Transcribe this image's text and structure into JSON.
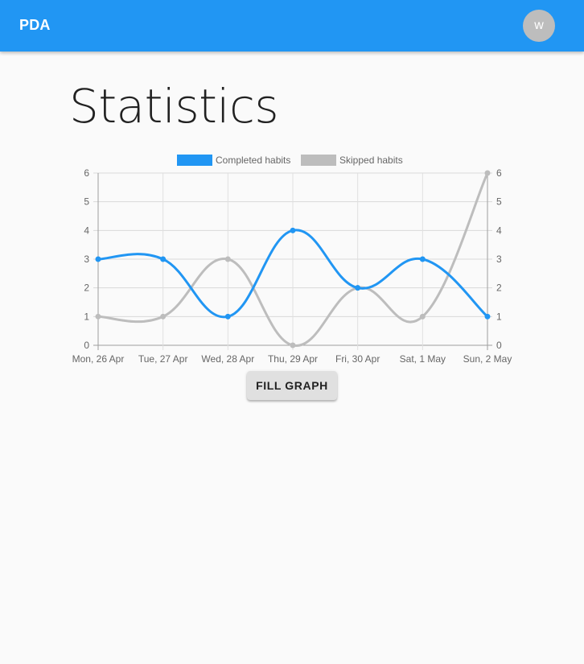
{
  "app": {
    "title": "PDA"
  },
  "user": {
    "avatar_initial": "w"
  },
  "page": {
    "title": "Statistics"
  },
  "actions": {
    "fill_graph_label": "FILL GRAPH"
  },
  "colors": {
    "primary": "#2196f3",
    "skipped": "#bdbdbd",
    "avatar": "#bdbdbd"
  },
  "chart_data": {
    "type": "line",
    "categories": [
      "Mon, 26 Apr",
      "Tue, 27 Apr",
      "Wed, 28 Apr",
      "Thu, 29 Apr",
      "Fri, 30 Apr",
      "Sat, 1 May",
      "Sun, 2 May"
    ],
    "series": [
      {
        "name": "Completed habits",
        "color": "#2196f3",
        "values": [
          3,
          3,
          1,
          4,
          2,
          3,
          1
        ]
      },
      {
        "name": "Skipped habits",
        "color": "#bdbdbd",
        "values": [
          1,
          1,
          3,
          0,
          2,
          1,
          6
        ]
      }
    ],
    "ylim": [
      0,
      6
    ],
    "yticks": [
      0,
      1,
      2,
      3,
      4,
      5,
      6
    ],
    "dual_y_axis": true,
    "grid": true,
    "smooth": true,
    "legend": "top"
  }
}
